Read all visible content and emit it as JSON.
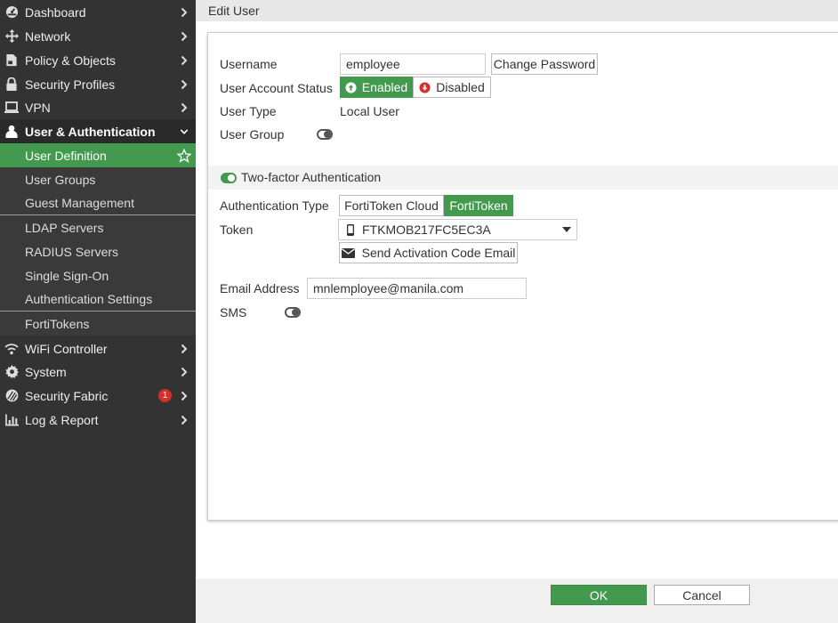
{
  "colors": {
    "sidebar_bg": "#333333",
    "accent_green": "#439a4e",
    "badge_red": "#d4302a"
  },
  "sidebar": {
    "top_items": [
      {
        "label": "Dashboard",
        "icon": "dashboard-icon"
      },
      {
        "label": "Network",
        "icon": "network-icon"
      },
      {
        "label": "Policy & Objects",
        "icon": "policy-icon"
      },
      {
        "label": "Security Profiles",
        "icon": "lock-icon"
      },
      {
        "label": "VPN",
        "icon": "laptop-icon"
      }
    ],
    "expanded_item": {
      "label": "User & Authentication",
      "icon": "user-icon"
    },
    "sub_items": [
      {
        "label": "User Definition",
        "active": true
      },
      {
        "label": "User Groups"
      },
      {
        "label": "Guest Management"
      },
      {
        "label": "LDAP Servers"
      },
      {
        "label": "RADIUS Servers"
      },
      {
        "label": "Single Sign-On"
      },
      {
        "label": "Authentication Settings"
      },
      {
        "label": "FortiTokens"
      }
    ],
    "bottom_items": [
      {
        "label": "WiFi Controller",
        "icon": "wifi-icon"
      },
      {
        "label": "System",
        "icon": "gear-icon"
      },
      {
        "label": "Security Fabric",
        "icon": "fabric-icon",
        "badge": "1"
      },
      {
        "label": "Log & Report",
        "icon": "chart-icon"
      }
    ]
  },
  "page": {
    "title": "Edit User"
  },
  "form": {
    "username_label": "Username",
    "username_value": "employee",
    "change_password": "Change Password",
    "status_label": "User Account Status",
    "status_enabled": "Enabled",
    "status_disabled": "Disabled",
    "user_type_label": "User Type",
    "user_type_value": "Local User",
    "user_group_label": "User Group",
    "tfa_label": "Two-factor Authentication",
    "auth_type_label": "Authentication Type",
    "auth_cloud": "FortiToken Cloud",
    "auth_token": "FortiToken",
    "token_label": "Token",
    "token_value": "FTKMOB217FC5EC3A",
    "send_activation": "Send Activation Code Email",
    "email_label": "Email Address",
    "email_value": "mnlemployee@manila.com",
    "sms_label": "SMS"
  },
  "footer": {
    "ok": "OK",
    "cancel": "Cancel"
  }
}
